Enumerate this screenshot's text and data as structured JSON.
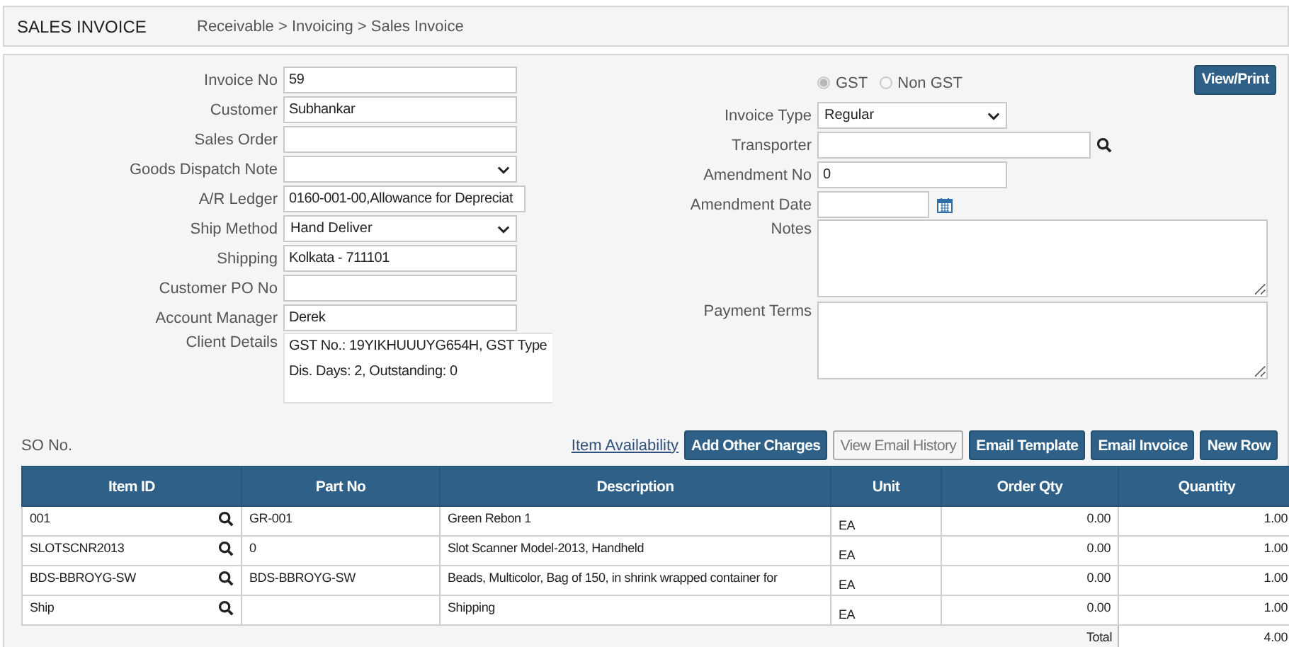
{
  "header": {
    "title": "SALES INVOICE",
    "breadcrumb": "Receivable > Invoicing > Sales Invoice"
  },
  "left_fields": [
    {
      "label": "Invoice No",
      "kind": "text",
      "value": "59"
    },
    {
      "label": "Customer",
      "kind": "text",
      "value": "Subhankar"
    },
    {
      "label": "Sales Order",
      "kind": "text"
    },
    {
      "label": "Goods Dispatch Note",
      "kind": "select"
    },
    {
      "label": "A/R Ledger",
      "kind": "text",
      "value": "0160-001-00,Allowance for Depreciat"
    },
    {
      "label": "Ship Method",
      "kind": "select",
      "value": "Hand Deliver"
    },
    {
      "label": "Shipping",
      "kind": "text",
      "value": "Kolkata - 711101"
    },
    {
      "label": "Customer PO No",
      "kind": "text"
    },
    {
      "label": "Account Manager",
      "kind": "text",
      "value": "Derek"
    },
    {
      "label": "Client Details",
      "kind": "details",
      "lines": [
        "GST No.: 19YIKHUUUYG654H, GST Type",
        "Dis. Days: 2, Outstanding: 0"
      ]
    }
  ],
  "tax_options": [
    {
      "label": "GST",
      "selected": true
    },
    {
      "label": "Non GST",
      "selected": false
    }
  ],
  "view_print_button": "View/Print",
  "right_fields": [
    {
      "label": "Invoice Type",
      "kind": "select",
      "value": "Regular"
    },
    {
      "label": "Transporter",
      "kind": "lookup"
    },
    {
      "label": "Amendment No",
      "kind": "text",
      "value": "0"
    },
    {
      "label": "Amendment Date",
      "kind": "date"
    },
    {
      "label": "Notes",
      "kind": "textarea"
    },
    {
      "label": "Payment Terms",
      "kind": "textarea"
    }
  ],
  "so_label": "SO No.",
  "availability_link": "Item Availability",
  "buttons": [
    {
      "label": "Add Other Charges",
      "disabled": false
    },
    {
      "label": "View Email History",
      "disabled": true
    },
    {
      "label": "Email Template",
      "disabled": false
    },
    {
      "label": "Email Invoice",
      "disabled": false
    },
    {
      "label": "New Row",
      "disabled": false
    }
  ],
  "table": {
    "columns": [
      "Item ID",
      "Part No",
      "Description",
      "Unit",
      "Order Qty",
      "Quantity"
    ],
    "rows": [
      {
        "item_id": "001",
        "part_no": "GR-001",
        "description": "Green Rebon 1",
        "unit": "EA",
        "order_qty": "0.00",
        "quantity": "1.00"
      },
      {
        "item_id": "SLOTSCNR2013",
        "part_no": "0",
        "description": "Slot Scanner Model-2013, Handheld",
        "unit": "EA",
        "order_qty": "0.00",
        "quantity": "1.00"
      },
      {
        "item_id": "BDS-BBROYG-SW",
        "part_no": "BDS-BBROYG-SW",
        "description": "Beads, Multicolor, Bag of 150, in shrink wrapped container for",
        "unit": "EA",
        "order_qty": "0.00",
        "quantity": "1.00"
      },
      {
        "item_id": "Ship",
        "part_no": "",
        "description": "Shipping",
        "unit": "EA",
        "order_qty": "0.00",
        "quantity": "1.00"
      }
    ],
    "total_label": "Total",
    "total_value": "4.00"
  }
}
